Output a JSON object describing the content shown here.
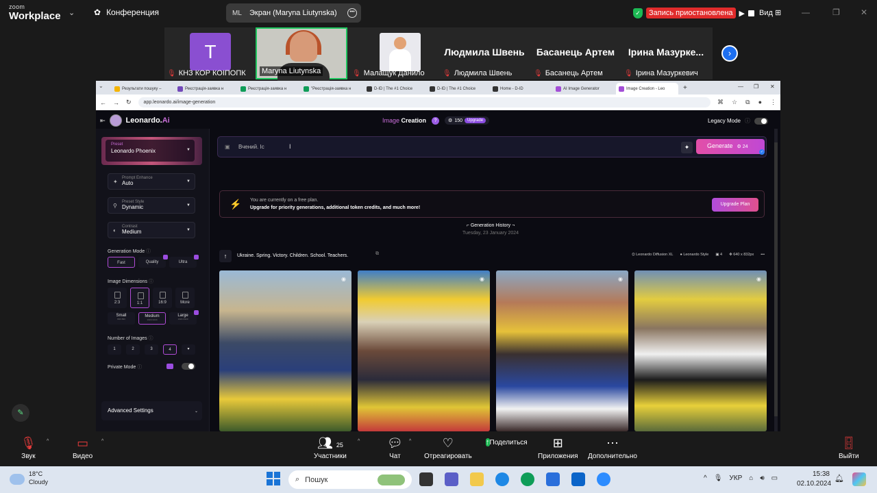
{
  "zoom": {
    "logo_top": "zoom",
    "logo_bottom": "Workplace",
    "conference": "Конференция",
    "share_avatar": "ML",
    "share_label": "Экран (Maryna Liutynska)",
    "recording": "Запись приостановлена",
    "view": "Вид",
    "participants": [
      {
        "name": "КНЗ КОР КОІПОПК",
        "initial": "T"
      },
      {
        "name": "Maryna Liutynska"
      },
      {
        "name": "Малащук Данило"
      },
      {
        "name": "Людмила Швень",
        "big": "Людмила Швень"
      },
      {
        "name": "Басанець Артем",
        "big": "Басанець Артем"
      },
      {
        "name": "Ірина Мазуркевич",
        "big": "Ірина Мазурке..."
      }
    ],
    "controls": {
      "audio": "Звук",
      "video": "Видео",
      "participants": "Участники",
      "participants_count": "25",
      "chat": "Чат",
      "react": "Отреагировать",
      "share": "Поделиться",
      "apps": "Приложения",
      "more": "Дополнительно",
      "leave": "Выйти"
    }
  },
  "browser": {
    "tabs": [
      {
        "label": "Результати пошуку –",
        "color": "#f4b400"
      },
      {
        "label": "Реєстрація-заявка н",
        "color": "#7248b9"
      },
      {
        "label": "Реєстрація-заявка н",
        "color": "#0f9d58"
      },
      {
        "label": "\"Реєстрація-заявка н",
        "color": "#0f9d58"
      },
      {
        "label": "D-ID | The #1 Choice",
        "color": "#333333"
      },
      {
        "label": "D-ID | The #1 Choice",
        "color": "#333333"
      },
      {
        "label": "Home - D-ID",
        "color": "#333333"
      },
      {
        "label": "AI Image Generator",
        "color": "#a34ed6"
      },
      {
        "label": "Image Creation - Leo",
        "color": "#a34ed6"
      }
    ],
    "url": "app.leonardo.ai/image-generation"
  },
  "leonardo": {
    "brand": "Leonardo.",
    "brand_ai": "Ai",
    "title_a": "Image",
    "title_b": "Creation",
    "tokens": "150",
    "upgrade": "Upgrade",
    "legacy": "Legacy Mode",
    "preset_label": "Preset",
    "preset_value": "Leonardo Phoenix",
    "prompt_enhance_label": "Prompt Enhance",
    "prompt_enhance_value": "Auto",
    "preset_style_label": "Preset Style",
    "preset_style_value": "Dynamic",
    "contrast_label": "Contrast",
    "contrast_value": "Medium",
    "generation_mode": "Generation Mode",
    "modes": [
      "Fast",
      "Quality",
      "Ultra"
    ],
    "image_dimensions": "Image Dimensions",
    "ratios": [
      "2:3",
      "1:1",
      "16:9",
      "More"
    ],
    "sizes": [
      {
        "name": "Small",
        "px": "896×896"
      },
      {
        "name": "Medium",
        "px": "1024×1024"
      },
      {
        "name": "Large",
        "px": "1920×1920"
      }
    ],
    "number_of_images": "Number of Images",
    "numbers": [
      "1",
      "2",
      "3",
      "4"
    ],
    "private_mode": "Private Mode",
    "advanced": "Advanced Settings",
    "prompt_text": "Вчений. Іс",
    "generate": "Generate",
    "generate_tokens": "24",
    "banner_1": "You are currently on a free plan.",
    "banner_2": "Upgrade for priority generations, additional token credits, and much more!",
    "upgrade_plan": "Upgrade Plan",
    "history": "Generation History",
    "history_date": "Tuesday, 23 January 2024",
    "gen_prompt": "Ukraine. Spring. Victory. Children. School. Teachers.",
    "meta_model": "Leonardo Diffusion XL",
    "meta_style": "Leonardo Style",
    "meta_count": "4",
    "meta_size": "640 x 832px"
  },
  "taskbar": {
    "temp": "18°C",
    "weather": "Cloudy",
    "search": "Пошук",
    "lang": "УКР",
    "time": "15:38",
    "date": "02.10.2024"
  }
}
